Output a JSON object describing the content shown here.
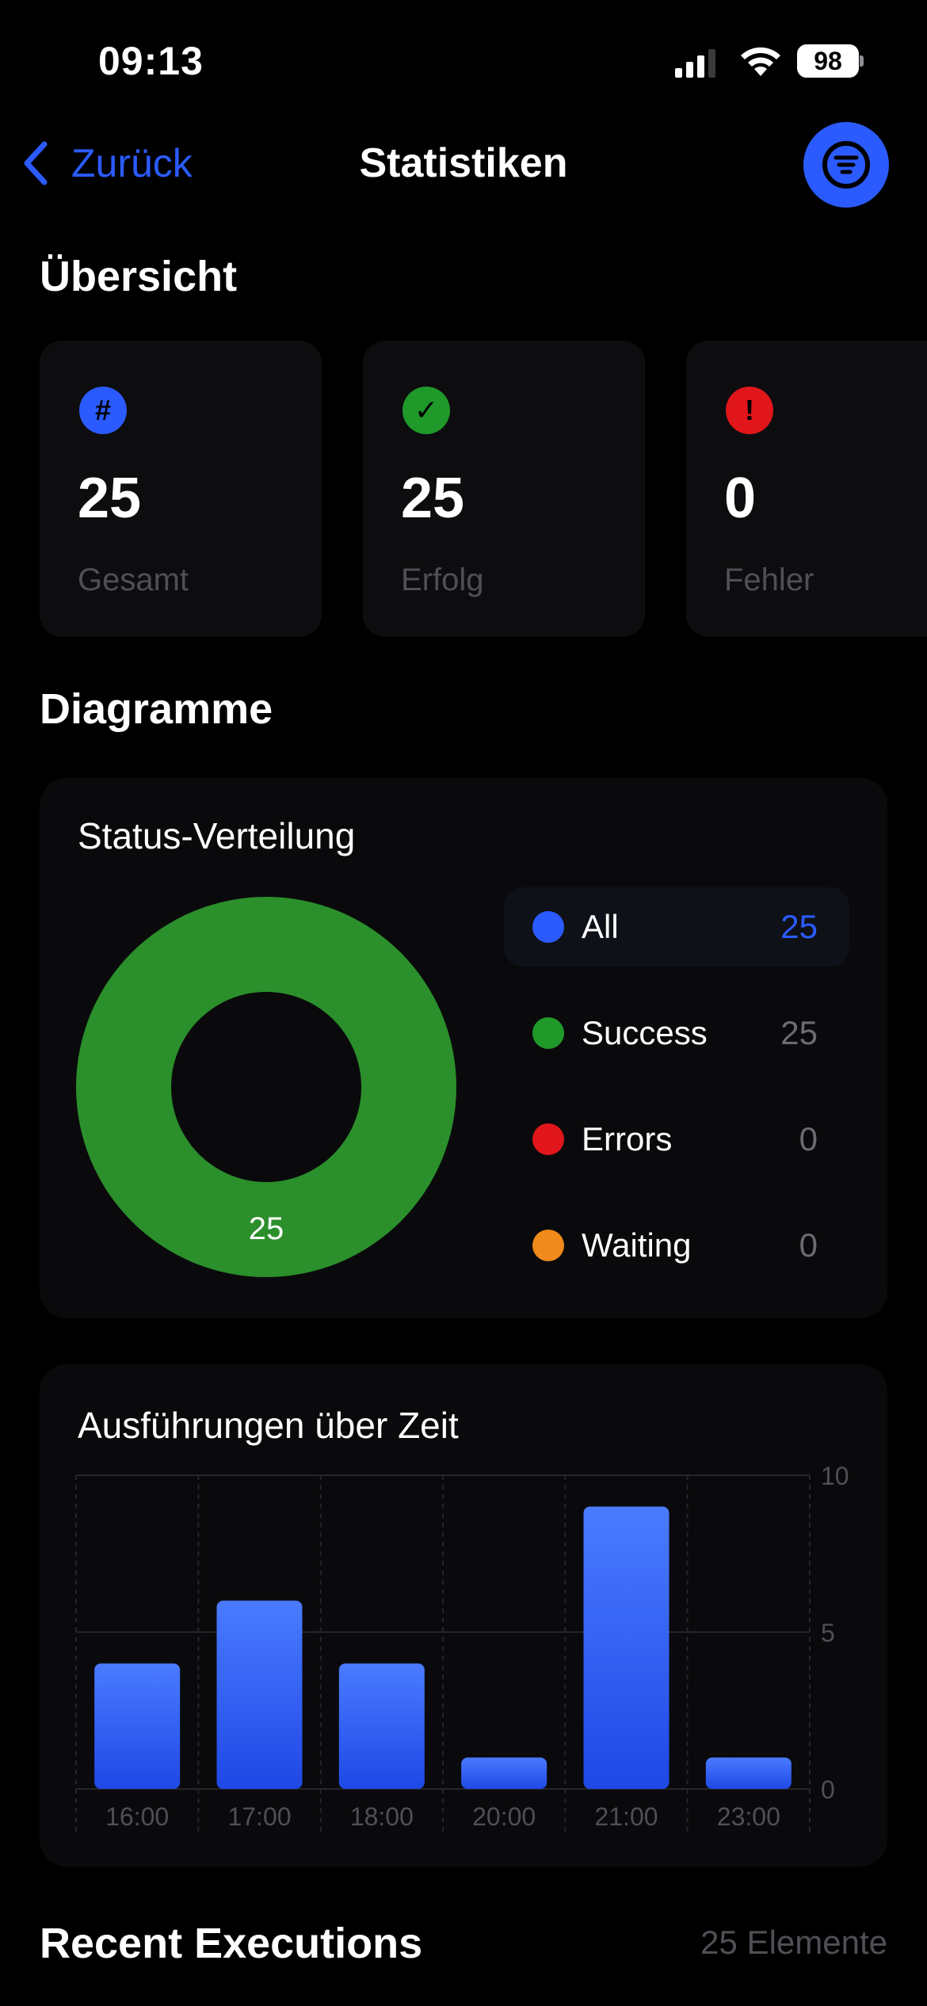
{
  "status_bar": {
    "time": "09:13",
    "battery": "98"
  },
  "nav": {
    "back_label": "Zurück",
    "title": "Statistiken"
  },
  "overview": {
    "heading": "Übersicht",
    "cards": [
      {
        "icon": "hash-icon",
        "icon_text": "#",
        "color": "#2b5bff",
        "value": "25",
        "label": "Gesamt"
      },
      {
        "icon": "checkmark-icon",
        "icon_text": "✓",
        "color": "#1f9a2a",
        "value": "25",
        "label": "Erfolg"
      },
      {
        "icon": "exclamation-icon",
        "icon_text": "!",
        "color": "#e0161b",
        "value": "0",
        "label": "Fehler"
      }
    ]
  },
  "charts": {
    "heading": "Diagramme",
    "status_panel": {
      "title": "Status-Verteilung",
      "center_label": "25",
      "legend": [
        {
          "label": "All",
          "count": "25",
          "color": "#2b5bff",
          "active": true
        },
        {
          "label": "Success",
          "count": "25",
          "color": "#1f9a2a",
          "active": false
        },
        {
          "label": "Errors",
          "count": "0",
          "color": "#e0161b",
          "active": false
        },
        {
          "label": "Waiting",
          "count": "0",
          "color": "#f08a1c",
          "active": false
        }
      ]
    },
    "time_panel": {
      "title": "Ausführungen über Zeit"
    }
  },
  "recent": {
    "heading": "Recent Executions",
    "count_label": "25 Elemente"
  },
  "chart_data": [
    {
      "type": "pie",
      "title": "Status-Verteilung",
      "categories": [
        "Success",
        "Errors",
        "Waiting"
      ],
      "values": [
        25,
        0,
        0
      ],
      "colors": [
        "#2b8f2b",
        "#e0161b",
        "#f08a1c"
      ],
      "donut": true
    },
    {
      "type": "bar",
      "title": "Ausführungen über Zeit",
      "categories": [
        "16:00",
        "17:00",
        "18:00",
        "20:00",
        "21:00",
        "23:00"
      ],
      "values": [
        4,
        6,
        4,
        1,
        9,
        1
      ],
      "ylim": [
        0,
        10
      ],
      "yticks": [
        0,
        5,
        10
      ],
      "color": "#2b5bff",
      "grid": true
    }
  ]
}
